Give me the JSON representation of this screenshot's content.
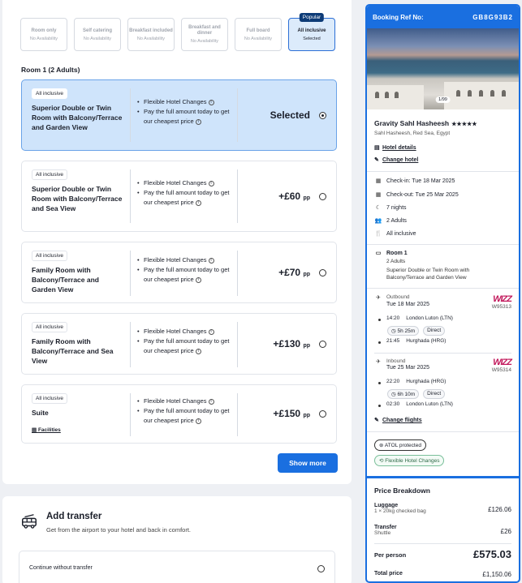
{
  "boards": [
    {
      "name": "Room only",
      "sub": "No Availability",
      "selected": false
    },
    {
      "name": "Self catering",
      "sub": "No Availability",
      "selected": false
    },
    {
      "name": "Breakfast included",
      "sub": "No Availability",
      "selected": false
    },
    {
      "name": "Breakfast and dinner",
      "sub": "No Availability",
      "selected": false
    },
    {
      "name": "Full board",
      "sub": "No Availability",
      "selected": false
    },
    {
      "name": "All inclusive",
      "sub": "Selected",
      "selected": true,
      "badge": "Popular"
    }
  ],
  "room_section_title": "Room 1 (2 Adults)",
  "feature_1": "Flexible Hotel Changes",
  "feature_2": "Pay the full amount today to get our cheapest price",
  "price_unit": "pp",
  "rooms": [
    {
      "tag": "All inclusive",
      "name": "Superior Double or Twin Room with Balcony/Terrace and Garden View",
      "price": "Selected",
      "selected": true
    },
    {
      "tag": "All inclusive",
      "name": "Superior Double or Twin Room with Balcony/Terrace and Sea View",
      "price": "+£60",
      "selected": false
    },
    {
      "tag": "All inclusive",
      "name": "Family Room with Balcony/Terrace and Garden View",
      "price": "+£70",
      "selected": false
    },
    {
      "tag": "All inclusive",
      "name": "Family Room with Balcony/Terrace and Sea View",
      "price": "+£130",
      "selected": false
    },
    {
      "tag": "All inclusive",
      "name": "Suite",
      "price": "+£150",
      "selected": false,
      "link": "Facilities"
    }
  ],
  "show_more": "Show more",
  "transfer": {
    "title": "Add transfer",
    "subtitle": "Get from the airport to your hotel and back in comfort.",
    "option": "Continue without transfer"
  },
  "summary": {
    "ref_label": "Booking Ref No:",
    "ref_value": "GB8G93B2",
    "image_counter": "1/99",
    "hotel_name": "Gravity Sahl Hasheesh",
    "stars": "★★★★★",
    "location": "Sahl Hasheesh, Red Sea, Egypt",
    "hotel_details": "Hotel details",
    "change_hotel": "Change hotel",
    "check_in": "Check-in: Tue 18 Mar 2025",
    "check_out": "Check-out: Tue 25 Mar 2025",
    "nights": "7 nights",
    "adults": "2 Adults",
    "board": "All inclusive",
    "room_label": "Room 1",
    "room_adults": "2 Adults",
    "room_name": "Superior Double or Twin Room with Balcony/Terrace and Garden View",
    "outbound": {
      "label": "Outbound",
      "date": "Tue 18 Mar 2025",
      "airline": "WIZZ",
      "flight": "W95313",
      "dep_time": "14:20",
      "dep_airport": "London Luton (LTN)",
      "duration": "5h 25m",
      "stops": "Direct",
      "arr_time": "21:45",
      "arr_airport": "Hurghada (HRG)"
    },
    "inbound": {
      "label": "Inbound",
      "date": "Tue 25 Mar 2025",
      "airline": "WIZZ",
      "flight": "W95314",
      "dep_time": "22:20",
      "dep_airport": "Hurghada (HRG)",
      "duration": "6h 10m",
      "stops": "Direct",
      "arr_time": "02:30",
      "arr_airport": "London Luton (LTN)"
    },
    "change_flights": "Change flights",
    "atol": "ATOL protected",
    "flex": "Flexible Hotel Changes"
  },
  "price_breakdown": {
    "title": "Price Breakdown",
    "luggage_label": "Luggage",
    "luggage_sub": "1 × 20kg checked bag",
    "luggage_price": "£126.06",
    "transfer_label": "Transfer",
    "transfer_sub": "Shuttle",
    "transfer_price": "£26",
    "per_person_label": "Per person",
    "per_person_price": "£575.03",
    "total_label": "Total price",
    "total_price": "£1,150.06"
  }
}
